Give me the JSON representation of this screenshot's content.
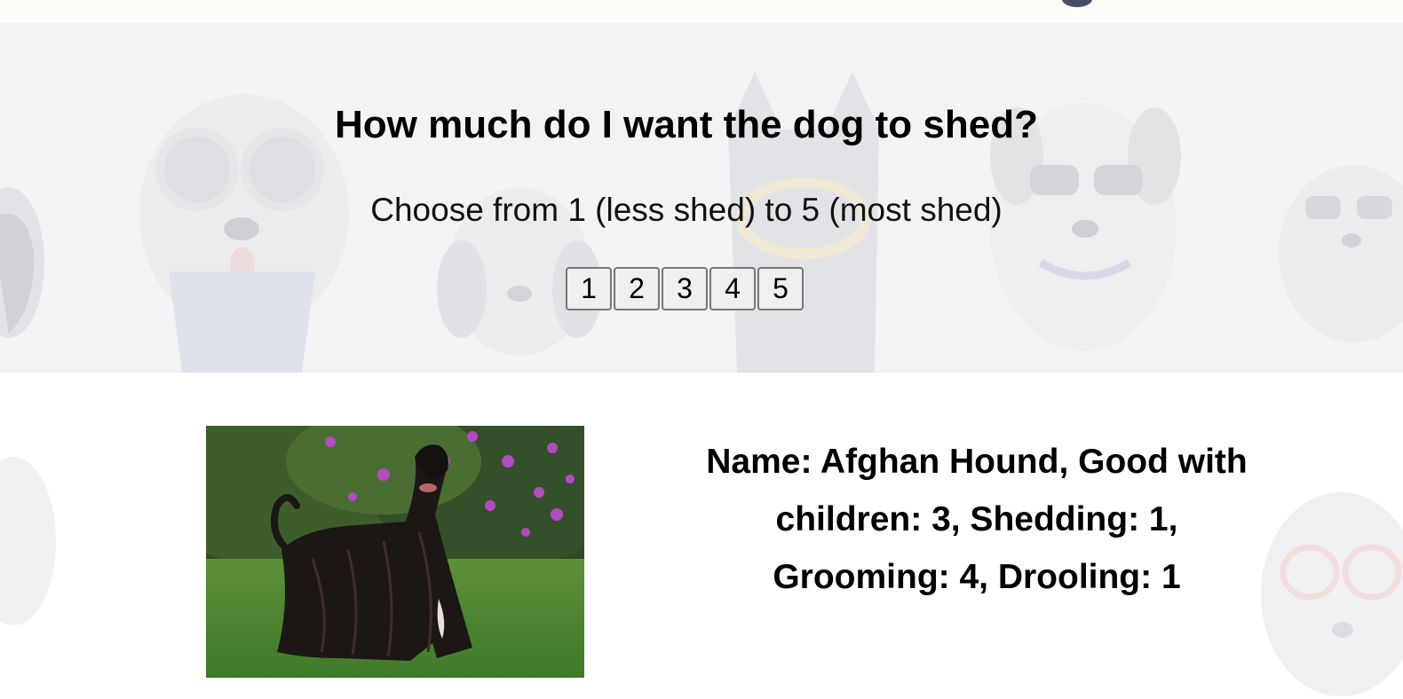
{
  "question": {
    "title": "How much do I want the dog to shed?",
    "instruction": "Choose from 1 (less shed) to 5 (most shed)"
  },
  "rating_options": [
    "1",
    "2",
    "3",
    "4",
    "5"
  ],
  "result": {
    "description": "Name: Afghan Hound, Good with children: 3, Shedding: 1, Grooming: 4, Drooling: 1"
  },
  "background": {
    "hero_color": "#f3f3f5",
    "pattern_icons": [
      "dog-with-sunglasses-icon",
      "dog-with-bandana-icon"
    ]
  }
}
